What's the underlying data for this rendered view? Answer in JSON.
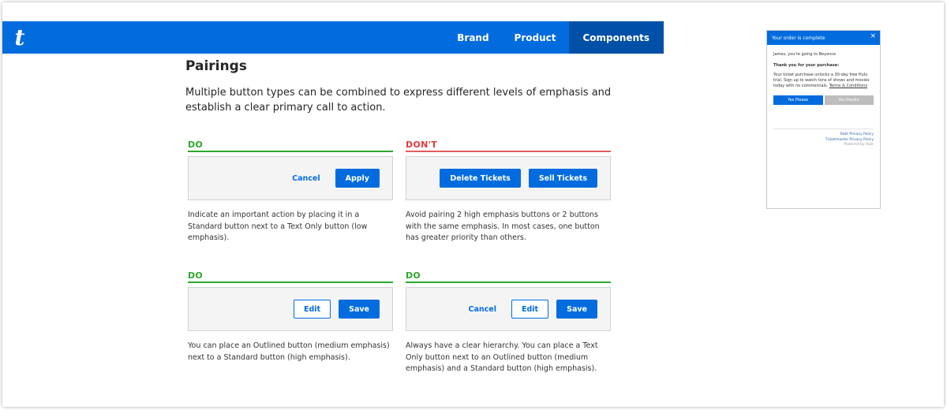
{
  "header": {
    "logo": "t",
    "nav": [
      {
        "label": "Brand"
      },
      {
        "label": "Product"
      },
      {
        "label": "Components"
      }
    ]
  },
  "section": {
    "title": "Pairings",
    "intro": "Multiple button types can be combined to express different levels of emphasis and establish a clear primary call to action."
  },
  "examples": [
    {
      "verdict": "DO",
      "buttons": [
        {
          "label": "Cancel",
          "variant": "text"
        },
        {
          "label": "Apply",
          "variant": "primary"
        }
      ],
      "description": "Indicate an important action by placing it in a Standard button next to a Text Only button (low emphasis)."
    },
    {
      "verdict": "DON'T",
      "buttons": [
        {
          "label": "Delete Tickets",
          "variant": "primary"
        },
        {
          "label": "Sell Tickets",
          "variant": "primary"
        }
      ],
      "description": "Avoid pairing 2 high emphasis buttons or 2 buttons with the same emphasis. In most cases, one button has greater priority than others."
    },
    {
      "verdict": "DO",
      "buttons": [
        {
          "label": "Edit",
          "variant": "outline"
        },
        {
          "label": "Save",
          "variant": "primary"
        }
      ],
      "description": "You can place an Outlined button (medium emphasis) next to a Standard button (high emphasis)."
    },
    {
      "verdict": "DO",
      "buttons": [
        {
          "label": "Cancel",
          "variant": "text"
        },
        {
          "label": "Edit",
          "variant": "outline"
        },
        {
          "label": "Save",
          "variant": "primary"
        }
      ],
      "description": "Always have a clear hierarchy. You can place a Text Only button next to an Outlined button (medium emphasis) and a Standard button (high emphasis)."
    }
  ],
  "modal": {
    "title": "Your order is complete",
    "close": "×",
    "greeting": "James, you're going to Beyonce",
    "thanks": "Thank you for your purchase:",
    "body": "Your ticket purchase unlocks a 30-day free Hulu trial. Sign up to watch tons of shows and movies today with no commercials.",
    "terms": "Terms & Conditions",
    "yes": "Yes Please",
    "no": "No thanks",
    "links": [
      "Rokt Privacy Policy",
      "Ticketmaster Privacy Policy"
    ],
    "powered": "Powered by Rokt"
  },
  "colors": {
    "brand_blue": "#026cdf",
    "nav_active": "#0150a8",
    "do_green": "#2ba82b",
    "dont_red": "#e33b3b"
  }
}
